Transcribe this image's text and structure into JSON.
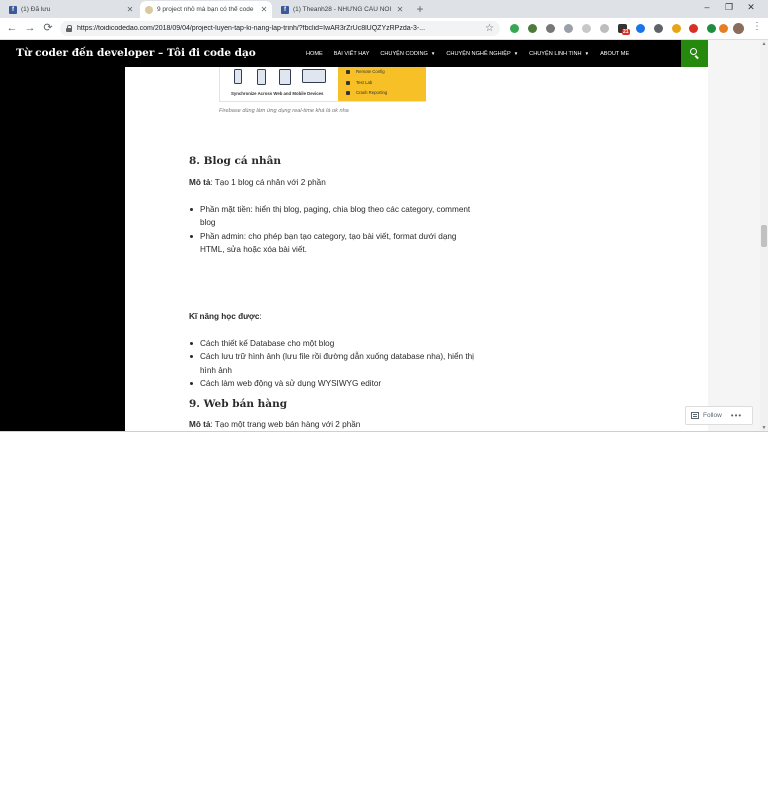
{
  "browser": {
    "tabs": [
      {
        "title": "(1) Đã lưu",
        "icon": "facebook-icon"
      },
      {
        "title": "9 project nhỏ mà bạn có thể code",
        "icon": "site-icon"
      },
      {
        "title": "(1) Theanh28 - NHỮNG CÂU NÓI",
        "icon": "facebook-icon"
      }
    ],
    "new_tab": "+",
    "window_controls": {
      "minimize": "–",
      "maximize": "❐",
      "close": "✕"
    },
    "url": "https://toidicodedao.com/2018/09/04/project-luyen-tap-ki-nang-lap-trinh/?fbclid=IwAR3rZrUc8lUQZYzRPzda-3-...",
    "nav": {
      "back": "←",
      "forward": "→",
      "reload": "⟳"
    },
    "bookmark_star": "☆",
    "menu": "⋮",
    "extension_badge": "21"
  },
  "site": {
    "title": "Từ coder đến developer – Tôi đi code dạo",
    "nav": [
      {
        "label": "HOME",
        "dropdown": false
      },
      {
        "label": "BÀI VIẾT HAY",
        "dropdown": false
      },
      {
        "label": "CHUYỆN CODING",
        "dropdown": true
      },
      {
        "label": "CHUYỆN NGHỀ NGHIỆP",
        "dropdown": true
      },
      {
        "label": "CHUYỆN LINH TINH",
        "dropdown": true
      },
      {
        "label": "ABOUT ME",
        "dropdown": false
      }
    ],
    "accent": "#24890d"
  },
  "article": {
    "figure": {
      "inner_caption": "Synchronize Across Web and Mobile Devices",
      "features": [
        "Remote Config",
        "Test Lab",
        "Crash Reporting"
      ],
      "caption": "Firebase dùng làm ứng dụng real-time khá là ok nha"
    },
    "section8": {
      "heading": "8. Blog cá nhân",
      "desc_label": "Mô tả",
      "desc_text": ": Tạo 1 blog cá nhân với 2 phần",
      "parts": [
        "Phần mặt tiền: hiển thị blog, paging, chia blog theo các category, comment blog",
        "Phần admin: cho phép bạn tạo category, tạo bài viết, format dưới dạng HTML, sửa hoặc xóa bài viết."
      ],
      "skills_label": "Kĩ năng học được",
      "skills_colon": ":",
      "skills": [
        "Cách thiết kế Database cho một blog",
        "Cách lưu trữ hình ảnh (lưu file rồi đường dẫn xuống database nha), hiển thị hình ảnh",
        "Cách làm web động và sử dụng WYSIWYG editor"
      ]
    },
    "section9": {
      "heading": "9. Web bán hàng",
      "desc_label": "Mô tả",
      "desc_text": ": Tạo một trang web bán hàng với 2 phần"
    }
  },
  "follow": {
    "label": "Follow",
    "more": "•••"
  }
}
